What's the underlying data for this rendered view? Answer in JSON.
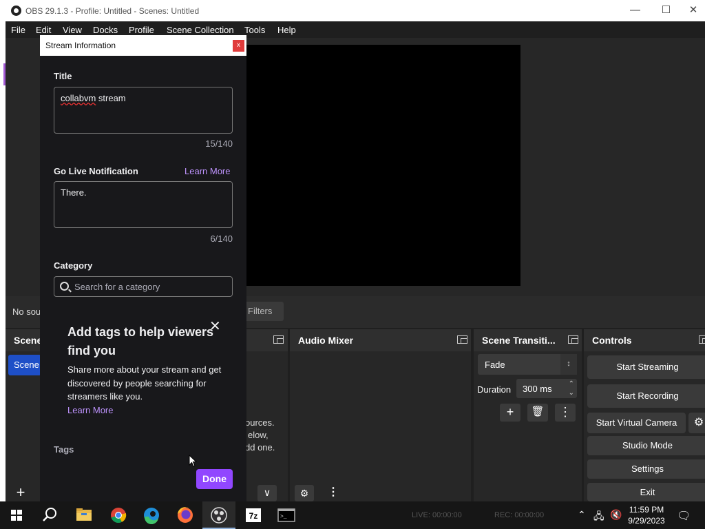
{
  "window": {
    "title": "OBS 29.1.3 - Profile: Untitled - Scenes: Untitled",
    "minimize": "—",
    "maximize": "☐",
    "close": "✕"
  },
  "menu": [
    "File",
    "Edit",
    "View",
    "Docks",
    "Profile",
    "Scene Collection",
    "Tools",
    "Help"
  ],
  "source_bar": {
    "no_source": "No sou",
    "filters": "Filters"
  },
  "docks": {
    "scenes": {
      "title": "Scene",
      "item": "Scene"
    },
    "sources": {
      "hint_lines": [
        "ources.",
        "elow,",
        "dd one."
      ]
    },
    "audio_mixer": {
      "title": "Audio Mixer"
    },
    "scene_transitions": {
      "title": "Scene Transiti...",
      "transition": "Fade",
      "duration_label": "Duration",
      "duration_value": "300 ms"
    },
    "controls": {
      "title": "Controls",
      "start_streaming": "Start Streaming",
      "start_recording": "Start Recording",
      "start_virtual_camera": "Start Virtual Camera",
      "studio_mode": "Studio Mode",
      "settings": "Settings",
      "exit": "Exit"
    }
  },
  "dialog": {
    "title": "Stream Information",
    "close": "x",
    "title_label": "Title",
    "title_value_word": "collabvm",
    "title_value_rest": " stream",
    "title_count": "15/140",
    "go_live_label": "Go Live Notification",
    "go_live_learn_more": "Learn More",
    "go_live_value": "There.",
    "go_live_count": "6/140",
    "category_label": "Category",
    "category_placeholder": "Search for a category",
    "promo_title": "Add tags to help viewers find you",
    "promo_body": "Share more about your stream and get discovered by people searching for streamers like you.",
    "promo_learn_more": "Learn More",
    "tags_label": "Tags",
    "done": "Done"
  },
  "taskbar": {
    "live": "LIVE: 00:00:00",
    "rec": "REC: 00:00:00",
    "time": "11:59 PM",
    "date": "9/29/2023",
    "apps": [
      "windows-start",
      "search",
      "file-explorer",
      "chrome",
      "edge",
      "firefox",
      "obs",
      "7zip",
      "terminal"
    ]
  },
  "colors": {
    "accent_purple": "#9147ff",
    "link_purple": "#bf94ff",
    "scene_selected": "#1e4fc7",
    "close_red": "#e03b3b"
  }
}
